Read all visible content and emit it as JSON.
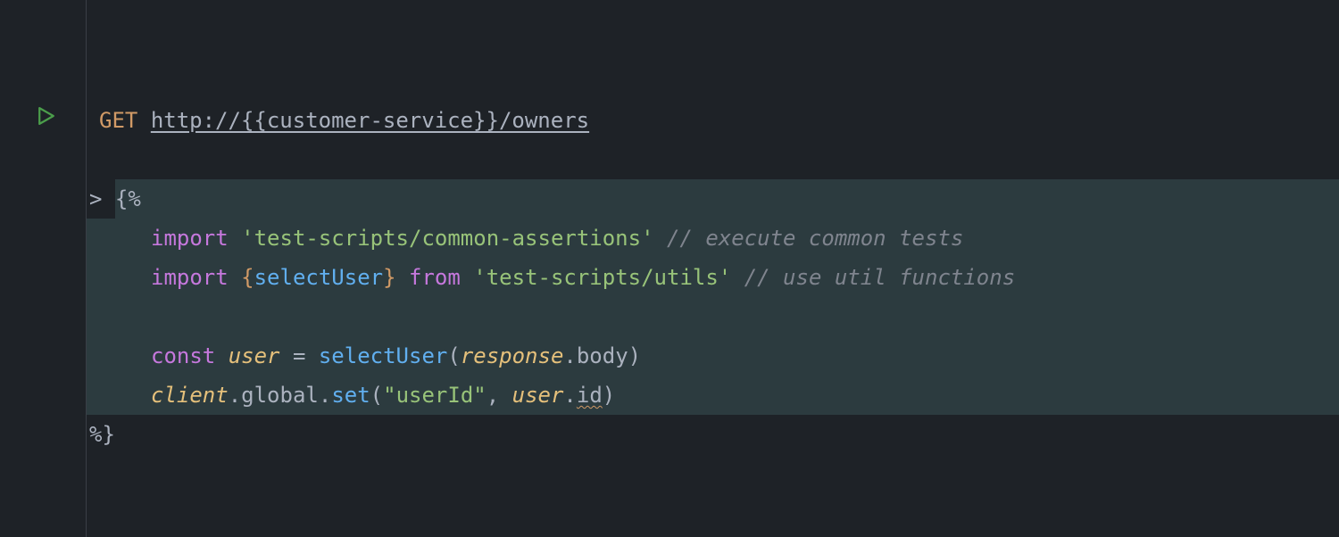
{
  "request": {
    "method": "GET",
    "url": "http://{{customer-service}}/owners"
  },
  "script": {
    "open": "> {%",
    "lines": {
      "import1": {
        "kw": "import",
        "str": "'test-scripts/common-assertions'",
        "comment": "// execute common tests"
      },
      "import2": {
        "kw": "import",
        "lbrace": "{",
        "name": "selectUser",
        "rbrace": "}",
        "from": "from",
        "str": "'test-scripts/utils'",
        "comment": "// use util functions"
      },
      "const1": {
        "kw": "const",
        "var": "user",
        "eq": " = ",
        "fn": "selectUser",
        "lp": "(",
        "arg": "response",
        "dot": ".",
        "prop": "body",
        "rp": ")"
      },
      "set1": {
        "obj": "client",
        "d1": ".",
        "p1": "global",
        "d2": ".",
        "fn": "set",
        "lp": "(",
        "str": "\"userId\"",
        "comma": ", ",
        "arg": "user",
        "d3": ".",
        "prop": "id",
        "rp": ")"
      }
    },
    "close": "%}"
  }
}
